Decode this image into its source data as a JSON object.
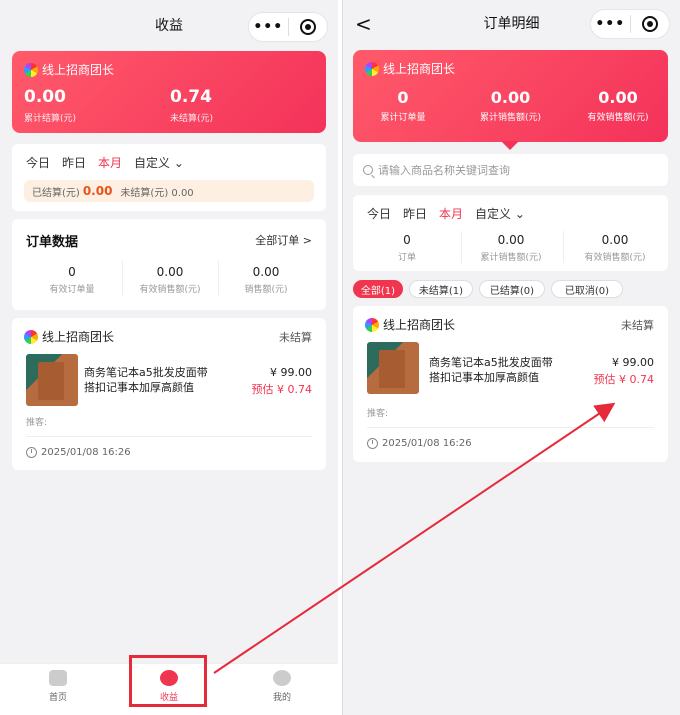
{
  "left": {
    "nav_title": "收益",
    "capsule_dots": "•••",
    "card": {
      "brand": "线上招商团长",
      "settled_value": "0.00",
      "settled_label": "累计结算(元)",
      "unsettled_value": "0.74",
      "unsettled_label": "未结算(元)"
    },
    "tabs": [
      "今日",
      "昨日",
      "本月",
      "自定义"
    ],
    "active_tab": 2,
    "note": {
      "settled_label": "已结算(元)",
      "settled_value": "0.00",
      "unsettled_text": "未结算(元) 0.00"
    },
    "order_data": {
      "title": "订单数据",
      "link": "全部订单 >",
      "stats": [
        {
          "value": "0",
          "label": "有效订单量"
        },
        {
          "value": "0.00",
          "label": "有效销售额(元)"
        },
        {
          "value": "0.00",
          "label": "销售额(元)"
        }
      ]
    },
    "order": {
      "brand": "线上招商团长",
      "status": "未结算",
      "title_line1": "商务笔记本a5批发皮面带",
      "title_line2": "搭扣记事本加厚高颜值",
      "price": "¥ 99.00",
      "estimate": "预估 ¥ 0.74",
      "recommender": "推客:",
      "time": "2025/01/08 16:26"
    },
    "tabbar": [
      {
        "label": "首页"
      },
      {
        "label": "收益"
      },
      {
        "label": "我的"
      }
    ]
  },
  "right": {
    "nav_title": "订单明细",
    "back": "<",
    "capsule_dots": "•••",
    "card": {
      "brand": "线上招商团长",
      "stats": [
        {
          "value": "0",
          "label": "累计订单量"
        },
        {
          "value": "0.00",
          "label": "累计销售额(元)"
        },
        {
          "value": "0.00",
          "label": "有效销售额(元)"
        }
      ]
    },
    "search_placeholder": "请输入商品名称关键词查询",
    "tabs": [
      "今日",
      "昨日",
      "本月",
      "自定义"
    ],
    "active_tab": 2,
    "stats": [
      {
        "value": "0",
        "label": "订单"
      },
      {
        "value": "0.00",
        "label": "累计销售额(元)"
      },
      {
        "value": "0.00",
        "label": "有效销售额(元)"
      }
    ],
    "filters": [
      "全部(1)",
      "未结算(1)",
      "已结算(0)",
      "已取消(0)"
    ],
    "active_filter": 0,
    "order": {
      "brand": "线上招商团长",
      "status": "未结算",
      "title_line1": "商务笔记本a5批发皮面带",
      "title_line2": "搭扣记事本加厚高颜值",
      "price": "¥ 99.00",
      "estimate": "预估 ¥ 0.74",
      "recommender": "推客:",
      "time": "2025/01/08 16:26"
    }
  },
  "colors": {
    "accent": "#f0354f",
    "arrow": "#e52a3a"
  }
}
